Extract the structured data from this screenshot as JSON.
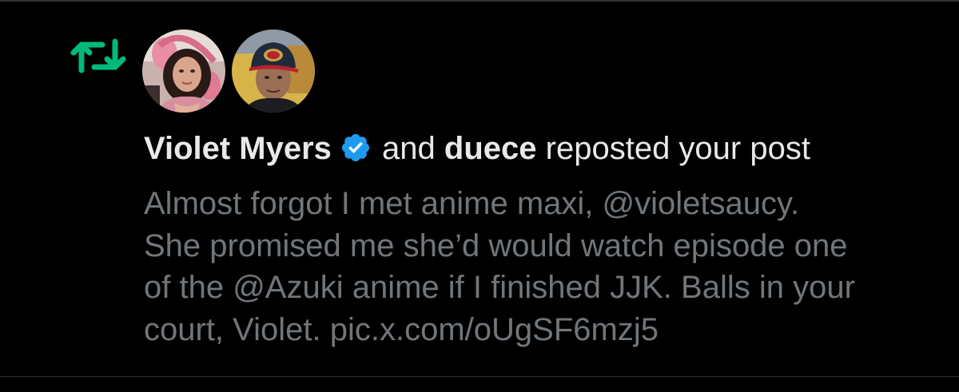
{
  "notification": {
    "type_icon": "repost-icon",
    "avatars": [
      {
        "name": "violet-myers-avatar",
        "icon": "avatar-photo"
      },
      {
        "name": "duece-avatar",
        "icon": "avatar-photo"
      }
    ],
    "user1_name": "Violet Myers",
    "user1_verified_icon": "verified-badge-icon",
    "connector": "and",
    "user2_name": "duece",
    "action_text": "reposted your post",
    "post_lines": [
      "Almost forgot I met anime maxi, @violetsaucy.",
      "She promised me she’d would watch episode one",
      "of the @Azuki anime if I finished JJK. Balls in your",
      "court, Violet. pic.x.com/oUgSF6mzj5"
    ]
  },
  "colors": {
    "background": "#000000",
    "repost_green": "#00ba7c",
    "verified_blue": "#1d9bf0",
    "primary_text": "#e7e9ea",
    "secondary_text": "#71767b",
    "divider": "#2f3336"
  }
}
